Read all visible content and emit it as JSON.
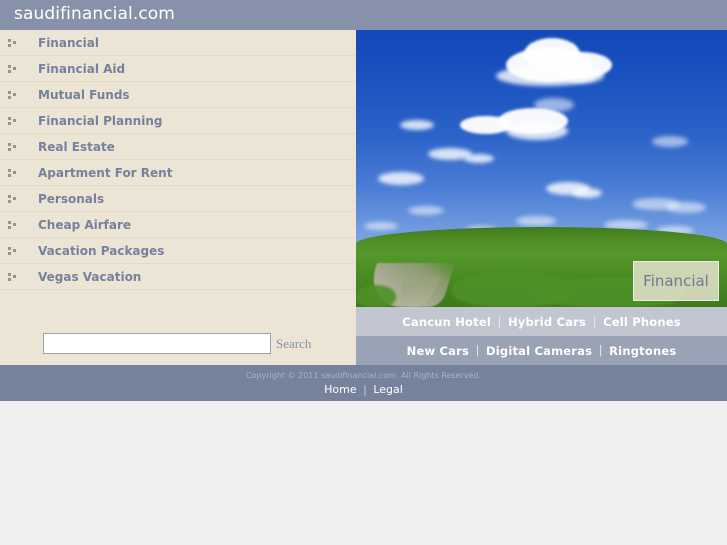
{
  "header": {
    "title": "saudifinancial.com"
  },
  "sidebar": {
    "items": [
      {
        "label": "Financial",
        "icon": "bullet-squares-icon"
      },
      {
        "label": "Financial Aid",
        "icon": "bullet-squares-icon"
      },
      {
        "label": "Mutual Funds",
        "icon": "bullet-squares-icon"
      },
      {
        "label": "Financial Planning",
        "icon": "bullet-squares-icon"
      },
      {
        "label": "Real Estate",
        "icon": "bullet-squares-icon"
      },
      {
        "label": "Apartment For Rent",
        "icon": "bullet-squares-icon"
      },
      {
        "label": "Personals",
        "icon": "bullet-squares-icon"
      },
      {
        "label": "Cheap Airfare",
        "icon": "bullet-squares-icon"
      },
      {
        "label": "Vacation Packages",
        "icon": "bullet-squares-icon"
      },
      {
        "label": "Vegas Vacation",
        "icon": "bullet-squares-icon"
      }
    ]
  },
  "search": {
    "value": "",
    "placeholder": "",
    "button_label": "Search"
  },
  "hero": {
    "badge_label": "Financial",
    "alt": "blue sky with clouds over a green grass field with a dirt path"
  },
  "ad_links": {
    "row1": [
      {
        "label": "Cancun Hotel"
      },
      {
        "label": "Hybrid Cars"
      },
      {
        "label": "Cell Phones"
      }
    ],
    "row2": [
      {
        "label": "New Cars"
      },
      {
        "label": "Digital Cameras"
      },
      {
        "label": "Ringtones"
      }
    ],
    "separator": "|"
  },
  "footer": {
    "copyright": "Copyright © 2011 saudifinancial.com. All Rights Reserved.",
    "links": [
      {
        "label": "Home"
      },
      {
        "label": "Legal"
      }
    ],
    "separator": "|"
  },
  "colors": {
    "header_bg": "#8792aa",
    "sidebar_bg": "#ece5d5",
    "sidebar_text": "#76819b",
    "linkbar_row1_bg": "#c2c6d1",
    "linkbar_row2_bg": "#9aa2b6",
    "footer_bg": "#76829c",
    "page_bg": "#efefef"
  }
}
